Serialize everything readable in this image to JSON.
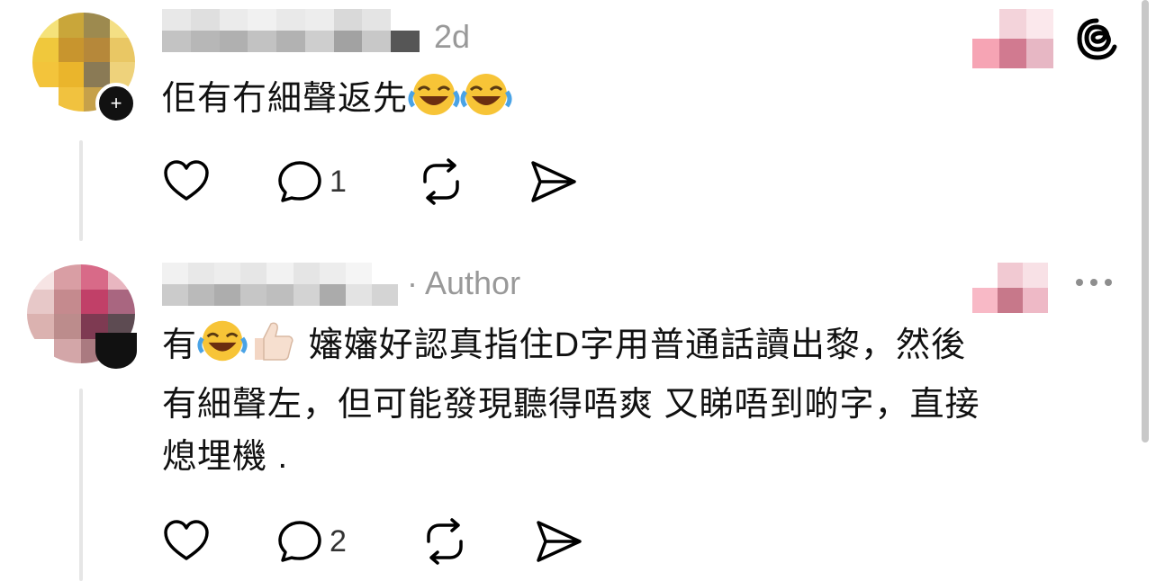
{
  "brand": {
    "icon": "threads-icon"
  },
  "comments": [
    {
      "name": "",
      "time": "2d",
      "author_tag": "",
      "text": "佢有冇細聲返先😂😂",
      "text_main": "佢有冇細聲返先",
      "actions": {
        "like": "heart-icon",
        "reply": "comment-icon",
        "reply_count": "1",
        "repost": "repost-icon",
        "share": "send-icon"
      }
    },
    {
      "name": "",
      "time": "",
      "author_tag": "· Author",
      "text": "有😂👍🏻 嬸嬸好認真指住D字用普通話讀出黎，然後有細聲左，但可能發現聽得唔爽 又睇唔到啲字，直接熄埋機 .",
      "line1_a": "有",
      "line1_b": "嬸嬸好認真指住D字用普通話讀出黎，然後",
      "line2": "有細聲左，但可能發現聽得唔爽 又睇唔到啲字，直接",
      "line3": "熄埋機 .",
      "actions": {
        "like": "heart-icon",
        "reply": "comment-icon",
        "reply_count": "2",
        "repost": "repost-icon",
        "share": "send-icon"
      }
    }
  ],
  "more_icon": "more-options-icon"
}
